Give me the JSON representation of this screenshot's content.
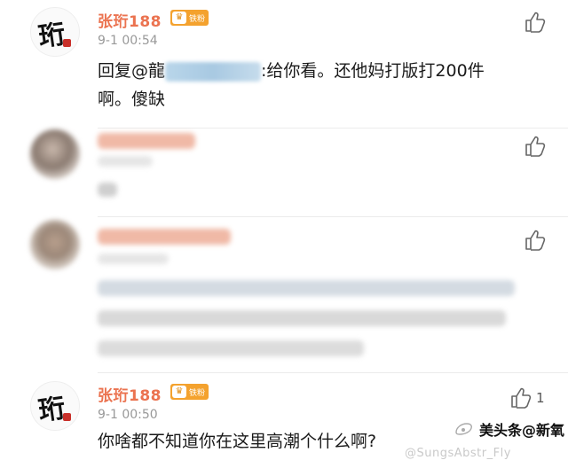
{
  "comments": [
    {
      "username": "张珩188",
      "badge": "铁粉",
      "time": "9-1 00:54",
      "reply_prefix": "回复@",
      "reply_mention": "龍",
      "reply_rest": ":给你看。还他妈打版打200件",
      "reply_line2": "啊。傻缺",
      "like_count": ""
    },
    {
      "username": "",
      "time": "",
      "text": "",
      "like_count": ""
    },
    {
      "username": "",
      "time": "",
      "text": "",
      "like_count": ""
    },
    {
      "username": "张珩188",
      "badge": "铁粉",
      "time": "9-1 00:50",
      "text": "你啥都不知道你在这里高潮个什么啊?",
      "like_count": "1"
    }
  ],
  "icons": {
    "like": "thumbs-up-icon",
    "avatar_logo": "calligraphy-avatar"
  },
  "watermark": {
    "handle": "@SungsAbstr_Fly",
    "brand": "美头条@新氧"
  },
  "colors": {
    "username": "#eb7350",
    "badge": "#f4a22e",
    "time": "#999999"
  }
}
